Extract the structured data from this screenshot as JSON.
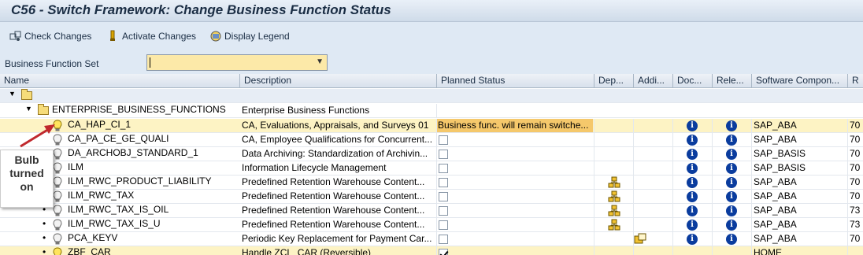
{
  "window": {
    "title": "C56 - Switch Framework: Change Business Function Status"
  },
  "toolbar": {
    "check_changes": "Check Changes",
    "activate_changes": "Activate Changes",
    "display_legend": "Display Legend"
  },
  "bf_set": {
    "label": "Business Function Set",
    "value": ""
  },
  "columns": {
    "name": "Name",
    "description": "Description",
    "planned_status": "Planned Status",
    "dep": "Dep...",
    "addi": "Addi...",
    "doc": "Doc...",
    "rel": "Rele...",
    "software_component": "Software Compon...",
    "r": "R"
  },
  "tree": {
    "group_name": "ENTERPRISE_BUSINESS_FUNCTIONS",
    "group_description": "Enterprise Business Functions"
  },
  "rows": [
    {
      "name": "CA_HAP_CI_1",
      "description": "CA, Evaluations, Appraisals, and Surveys 01",
      "planned": "Business func. will remain switche...",
      "software": "SAP_ABA",
      "r": "70"
    },
    {
      "name": "CA_PA_CE_GE_QUALI",
      "description": "CA, Employee Qualifications for Concurrent...",
      "planned": "",
      "software": "SAP_ABA",
      "r": "70"
    },
    {
      "name": "DA_ARCHOBJ_STANDARD_1",
      "description": "Data Archiving: Standardization of Archivin...",
      "planned": "",
      "software": "SAP_BASIS",
      "r": "70"
    },
    {
      "name": "ILM",
      "description": "Information Lifecycle Management",
      "planned": "",
      "software": "SAP_BASIS",
      "r": "70"
    },
    {
      "name": "ILM_RWC_PRODUCT_LIABILITY",
      "description": "Predefined Retention Warehouse Content...",
      "planned": "",
      "software": "SAP_ABA",
      "r": "70"
    },
    {
      "name": "ILM_RWC_TAX",
      "description": "Predefined Retention Warehouse Content...",
      "planned": "",
      "software": "SAP_ABA",
      "r": "70"
    },
    {
      "name": "ILM_RWC_TAX_IS_OIL",
      "description": "Predefined Retention Warehouse Content...",
      "planned": "",
      "software": "SAP_ABA",
      "r": "73"
    },
    {
      "name": "ILM_RWC_TAX_IS_U",
      "description": "Predefined Retention Warehouse Content...",
      "planned": "",
      "software": "SAP_ABA",
      "r": "73"
    },
    {
      "name": "PCA_KEYV",
      "description": "Periodic Key Replacement for Payment Car...",
      "planned": "",
      "software": "SAP_ABA",
      "r": "70"
    },
    {
      "name": "ZBF_CAR",
      "description": "Handle ZCL_CAR (Reversible)",
      "planned": "",
      "software": "HOME",
      "r": ""
    }
  ],
  "callout": {
    "line1": "Bulb",
    "line2": "turned",
    "line3": "on"
  },
  "colors": {
    "selected_row": "#fdf3c4",
    "planned_msg": "#f5c86b",
    "info_icon": "#0a3c9e",
    "arrow": "#c0282d"
  }
}
